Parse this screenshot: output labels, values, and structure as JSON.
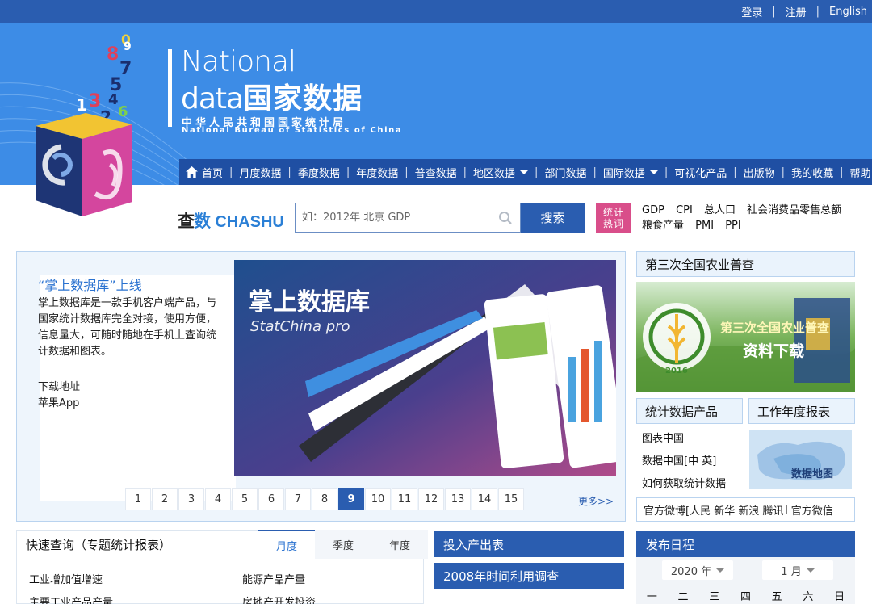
{
  "topbar": {
    "login": "登录",
    "register": "注册",
    "english": "English"
  },
  "logo": {
    "line1": "National",
    "line2_en": "data",
    "line2_cn": "国家数据",
    "org_cn": "中华人民共和国国家统计局",
    "org_en": "National Bureau of Statistics of China",
    "cube_numbers": [
      "0",
      "9",
      "8",
      "7",
      "5",
      "1",
      "3",
      "4",
      "6",
      "2"
    ]
  },
  "nav": [
    {
      "label": "首页",
      "icon": "home-icon"
    },
    {
      "label": "月度数据"
    },
    {
      "label": "季度数据"
    },
    {
      "label": "年度数据"
    },
    {
      "label": "普查数据"
    },
    {
      "label": "地区数据",
      "dropdown": true
    },
    {
      "label": "部门数据"
    },
    {
      "label": "国际数据",
      "dropdown": true
    },
    {
      "label": "可视化产品"
    },
    {
      "label": "出版物"
    },
    {
      "label": "我的收藏"
    },
    {
      "label": "帮助"
    }
  ],
  "search": {
    "brand_cn1": "查",
    "brand_cn2": "数",
    "brand_en": "CHASHU",
    "placeholder": "如：2012年 北京 GDP",
    "button": "搜索",
    "hot_badge_1": "统计",
    "hot_badge_2": "热词",
    "hotwords_row1": [
      "GDP",
      "CPI",
      "总人口",
      "社会消费品零售总额"
    ],
    "hotwords_row2": [
      "粮食产量",
      "PMI",
      "PPI"
    ]
  },
  "feature": {
    "title": "“掌上数据库”上线",
    "text": "掌上数据库是一款手机客户端产品，与国家统计数据库完全对接，使用方便，信息量大，可随时随地在手机上查询统计数据和图表。",
    "download_label": "下载地址",
    "app_label": "苹果App",
    "banner_title": "掌上数据库",
    "banner_subtitle": "StatChina pro",
    "pages": [
      "1",
      "2",
      "3",
      "4",
      "5",
      "6",
      "7",
      "8",
      "9",
      "10",
      "11",
      "12",
      "13",
      "14",
      "15"
    ],
    "active_page": "9",
    "more": "更多>>"
  },
  "right": {
    "census_title": "第三次全国农业普查",
    "census_banner_line1": "第三次全国农业普查",
    "census_banner_line2": "资料下载",
    "census_year": "2016",
    "products_title": "统计数据产品",
    "report_title": "工作年度报表",
    "links": [
      "图表中国",
      "数据中国[中 英]",
      "如何获取统计数据"
    ],
    "map_label": "数据地图",
    "social_prefix": "官方微博[",
    "social_items": [
      "人民",
      "新华",
      "新浪",
      "腾讯"
    ],
    "social_suffix": "]",
    "wechat": "官方微信"
  },
  "quick": {
    "title": "快速查询（专题统计报表）",
    "tabs": [
      "月度",
      "季度",
      "年度"
    ],
    "active_tab": "月度",
    "items": [
      "工业增加值增速",
      "能源产品产量",
      "主要工业产品产量",
      "房地产开发投资"
    ]
  },
  "middle_panels": {
    "io_table": "投入产出表",
    "time_survey": "2008年时间利用调查"
  },
  "calendar": {
    "title": "发布日程",
    "year": "2020 年",
    "month": "1 月",
    "weekdays": [
      "一",
      "二",
      "三",
      "四",
      "五",
      "六",
      "日"
    ]
  },
  "colors": {
    "brand_blue": "#2a5db0",
    "banner_blue": "#3d8ce6",
    "hot_pink": "#d94e8a",
    "link_blue": "#2a72d0"
  }
}
